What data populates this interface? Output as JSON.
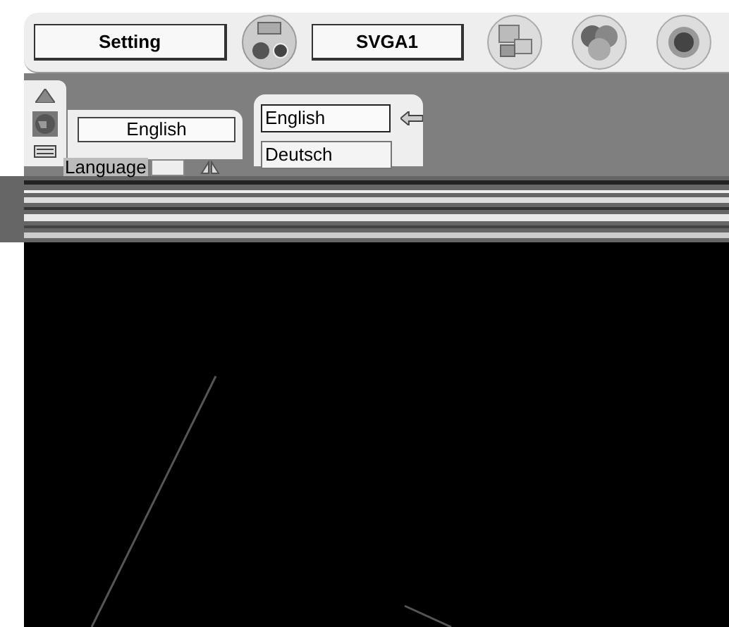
{
  "top_bar": {
    "menu_label": "Setting",
    "source_label": "SVGA1"
  },
  "side_menu": {
    "item_label": "Language"
  },
  "current_value": "English",
  "options": [
    {
      "label": "English",
      "selected": true
    },
    {
      "label": "Deutsch",
      "selected": false
    }
  ]
}
